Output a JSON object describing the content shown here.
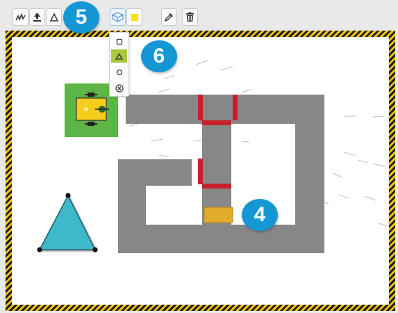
{
  "toolbar": {
    "buttons": [
      {
        "icon": "line-draw-icon"
      },
      {
        "icon": "upload-icon"
      },
      {
        "icon": "shape-icon"
      },
      {
        "icon": "3d-box-icon",
        "active": true
      },
      {
        "icon": "color-swatch-icon",
        "color": "#f5e200"
      },
      {
        "icon": "pipette-icon"
      },
      {
        "icon": "trash-icon"
      }
    ]
  },
  "shape_dropdown": {
    "options": [
      {
        "icon": "square-icon",
        "selected": false
      },
      {
        "icon": "triangle-icon",
        "selected": true
      },
      {
        "icon": "circle-icon",
        "selected": false
      },
      {
        "icon": "remove-circle-icon",
        "selected": false
      }
    ]
  },
  "callouts": [
    {
      "label": "5"
    },
    {
      "label": "6"
    },
    {
      "label": "4"
    }
  ],
  "scene": {
    "track_color": "#878787",
    "gate_color": "#c8202a",
    "robot_pad_color": "#5cb545",
    "robot_body_color": "#f5cd1d",
    "block_color": "#e0ac2b",
    "triangle_fill": "#3eb9cc",
    "frame_stripe_colors": [
      "#1e1e1e",
      "#f1c40f"
    ]
  }
}
